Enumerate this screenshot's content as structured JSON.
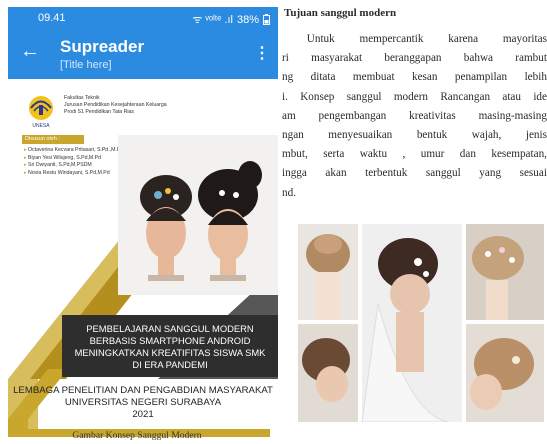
{
  "status_bar": {
    "time": "09.41",
    "signal": "ᯤ ᵛᵒˡᵗᵉ .ıl",
    "battery": "38%"
  },
  "app_bar": {
    "back_icon": "back-arrow-icon",
    "title": "Supreader",
    "subtitle": "[Title here]",
    "menu_icon": "more-vert-icon"
  },
  "cover": {
    "faculty_lines": [
      "Fakultas Teknik",
      "Jurusan Pendidikan Kesejahteraan Keluarga",
      "Prodi S1 Pendidikan Tata Rias"
    ],
    "logo_caption": "UNESA",
    "byline_label": "Disusun oleh :",
    "authors": [
      "Octaverina Kecvara Pritasari, S.Pd.,M.Farm",
      "Biyan Yesi Wilujeng, S.Pd,M.Pd",
      "Sri Dwiyanti, S.Pd,M.PSDM",
      "Novia Restu Windayani, S.Pd,M.Pd"
    ],
    "banner_lines": [
      "PEMBELAJARAN SANGGUL MODERN",
      "BERBASIS SMARTPHONE ANDROID",
      "MENINGKATKAN KREATIFITAS SISWA SMK",
      "DI ERA PANDEMI"
    ],
    "institution_lines": [
      "LEMBAGA PENELITIAN DAN PENGABDIAN MASYARAKAT",
      "UNIVERSITAS NEGERI SURABAYA",
      "2021"
    ],
    "colors": {
      "gold": "#c9a62c",
      "dark": "#2e2e2e",
      "blue": "#2a8be0"
    }
  },
  "document": {
    "heading": "Tujuan sanggul modern",
    "paragraph_lines": [
      [
        "",
        "Untuk",
        "mempercantik",
        "karena",
        "mayoritas"
      ],
      [
        "ri",
        "masyarakat",
        "beranggapan",
        "bahwa",
        "rambut"
      ],
      [
        "ng",
        "ditata",
        "membuat",
        "kesan",
        "penampilan",
        "lebih"
      ],
      [
        "i.",
        "Konsep",
        "sanggul",
        "modern",
        "Rancangan",
        "atau",
        "ide"
      ],
      [
        "am",
        "pengembangan",
        "kreativitas",
        "masing-masing"
      ],
      [
        "ngan",
        "menyesuaikan",
        "bentuk",
        "wajah,",
        "jenis"
      ],
      [
        "mbut,",
        "serta",
        "waktu",
        ",",
        "umur",
        "dan",
        "kesempatan,"
      ],
      [
        "ingga",
        "akan",
        "terbentuk",
        "sanggul",
        "yang",
        "sesuai"
      ],
      [
        "nd."
      ]
    ],
    "caption": "Gambar Konsep Sanggul Modern"
  }
}
